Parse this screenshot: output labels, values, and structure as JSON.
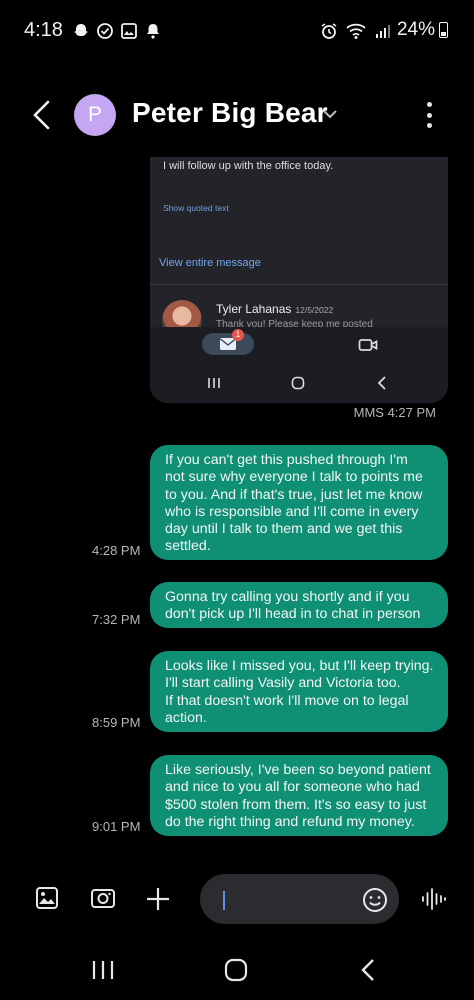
{
  "status_bar": {
    "time": "4:18",
    "left_icons": [
      "snapchat-icon",
      "check-circle-icon",
      "gallery-icon",
      "bell-icon"
    ],
    "right_icons": [
      "alarm-icon",
      "wifi-icon",
      "signal-icon"
    ],
    "battery": "24%"
  },
  "header": {
    "avatar_letter": "P",
    "avatar_color": "#c4a6f2",
    "contact_name": "Peter Big Bear"
  },
  "mms": {
    "body_text": "I will follow up with the office today.",
    "show_quoted": "Show quoted text",
    "view_entire": "View entire message",
    "sender_name": "Tyler Lahanas",
    "sender_date": "12/5/2022",
    "preview": "Thank you! Please keep me posted",
    "mail_badge": "1",
    "meta": "MMS 4:27 PM"
  },
  "messages": [
    {
      "time": "4:28 PM",
      "lines": [
        "If you can't get this pushed through I'm",
        "not sure why everyone I talk to points me",
        "to you. And if that's true, just let me know",
        "who is responsible and I'll come in every",
        "day until I talk to them and we get this",
        "settled."
      ]
    },
    {
      "time": "7:32 PM",
      "lines": [
        "Gonna try calling you shortly and if you",
        "don't pick up I'll head in to chat in person"
      ]
    },
    {
      "time": "8:59 PM",
      "lines": [
        "Looks like I missed you, but I'll keep trying.",
        "I'll start calling Vasily and Victoria too.",
        "If that doesn't work I'll move on to legal",
        "action."
      ]
    },
    {
      "time": "9:01 PM",
      "lines": [
        "Like seriously, I've been so beyond patient",
        "and nice to you all for someone who had",
        "$500 stolen from them. It's so easy to just",
        "do the right thing and refund my money."
      ]
    }
  ],
  "composer": {
    "placeholder": "",
    "accent": "#5f8fe8"
  },
  "colors": {
    "bubble": "#0f8f73",
    "background": "#000000"
  }
}
